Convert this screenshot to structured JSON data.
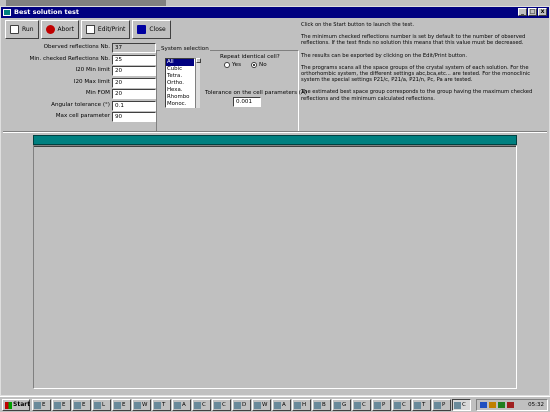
{
  "window": {
    "title": "Best solution test",
    "controls": [
      "_",
      "□",
      "x"
    ]
  },
  "toolbar": {
    "run_label": "Run",
    "abort_label": "Abort",
    "edit_print_label": "Edit/Print",
    "close_label": "Close"
  },
  "params": [
    {
      "label": "Oberved reflections Nb.",
      "value": "37"
    },
    {
      "label": "Min. checked Reflections Nb.",
      "value": "25"
    },
    {
      "label": "I20 Min limit",
      "value": "20"
    },
    {
      "label": "I20 Max limit",
      "value": "20"
    },
    {
      "label": "Min FOM",
      "value": "20"
    },
    {
      "label": "Angular tolerance (°)",
      "value": "0.1"
    },
    {
      "label": "Max cell parameter",
      "value": "90"
    }
  ],
  "system_selection": {
    "title": "System selection",
    "items": [
      "All",
      "Cubic",
      "Tetra.",
      "Ortho.",
      "Hexa.",
      "Rhombo",
      "Monoc."
    ],
    "selected_index": 0
  },
  "repeat": {
    "label": "Repeat identical cell?",
    "yes_label": "Yes",
    "no_label": "No",
    "selected": "No"
  },
  "tolerance": {
    "label": "Tolerance on the cell parameters (A)",
    "value": "0.001"
  },
  "help": [
    "Click on the Start button to launch the test.",
    "The minimum checked reflections number is set by default to the number of observed reflections. If the test finds no solution this means that this value must be decreased.",
    "The results can be exported by clicking on the Edit/Print button.",
    "The programs scans all the space groups of the crystal system of each solution. For the orthorhombic system, the different settings abc,bca,etc... are tested. For the monoclinic system the special settings P21/c, P21/a, P21/n, Pc, Pa are tested.",
    "The estimated best space group corresponds to the group having the maximum checked reflections and the minimum calculated reflections."
  ],
  "taskbar": {
    "start_label": "Start",
    "tasks": [
      "E",
      "E",
      "E",
      "L",
      "E",
      "W",
      "T",
      "A",
      "C",
      "C",
      "D",
      "W",
      "A",
      "H",
      "B",
      "G",
      "C",
      "P",
      "C",
      "T",
      "P",
      "C"
    ],
    "active_task_index": 21,
    "clock": "05:32"
  }
}
